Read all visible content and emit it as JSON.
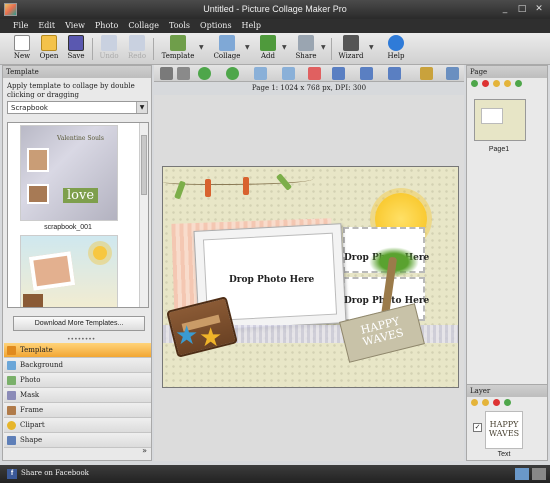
{
  "window": {
    "title": "Untitled - Picture Collage Maker Pro",
    "buttons": [
      "_",
      "□",
      "✕"
    ]
  },
  "menu": [
    "File",
    "Edit",
    "View",
    "Photo",
    "Collage",
    "Tools",
    "Options",
    "Help"
  ],
  "toolbar": {
    "new": "New",
    "open": "Open",
    "save": "Save",
    "undo": "Undo",
    "redo": "Redo",
    "template": "Template",
    "collage": "Collage",
    "add": "Add",
    "share": "Share",
    "wizard": "Wizard",
    "help": "Help"
  },
  "template_panel": {
    "header": "Template",
    "description": "Apply template to collage by double clicking or dragging",
    "category": "Scrapbook",
    "thumb1_label": "scrapbook_001",
    "thumb1_title": "Valentine Souls",
    "thumb1_text": "love",
    "download_button": "Download More Templates...",
    "categories": [
      "Template",
      "Background",
      "Photo",
      "Mask",
      "Frame",
      "Clipart",
      "Shape"
    ],
    "more": "»"
  },
  "page_info": "Page 1: 1024 x 768 px, DPI: 300",
  "canvas": {
    "drop_main": "Drop Photo Here",
    "drop_top": "Drop Photo Here",
    "drop_bottom": "Drop Photo Here",
    "tag_line1": "HAPPY",
    "tag_line2": "WAVES"
  },
  "page_panel": {
    "header": "Page",
    "page_label": "Page1"
  },
  "layer_panel": {
    "header": "Layer",
    "layer_text_1": "HAPPY",
    "layer_text_2": "WAVES",
    "layer_label": "Text",
    "checked": "✓"
  },
  "statusbar": {
    "facebook": "Share on Facebook",
    "fb_icon": "f"
  },
  "colors": {
    "accent": "#f2a633",
    "canvas_bg": "#e8e6c7",
    "titlebar": "#2f2f2f"
  }
}
